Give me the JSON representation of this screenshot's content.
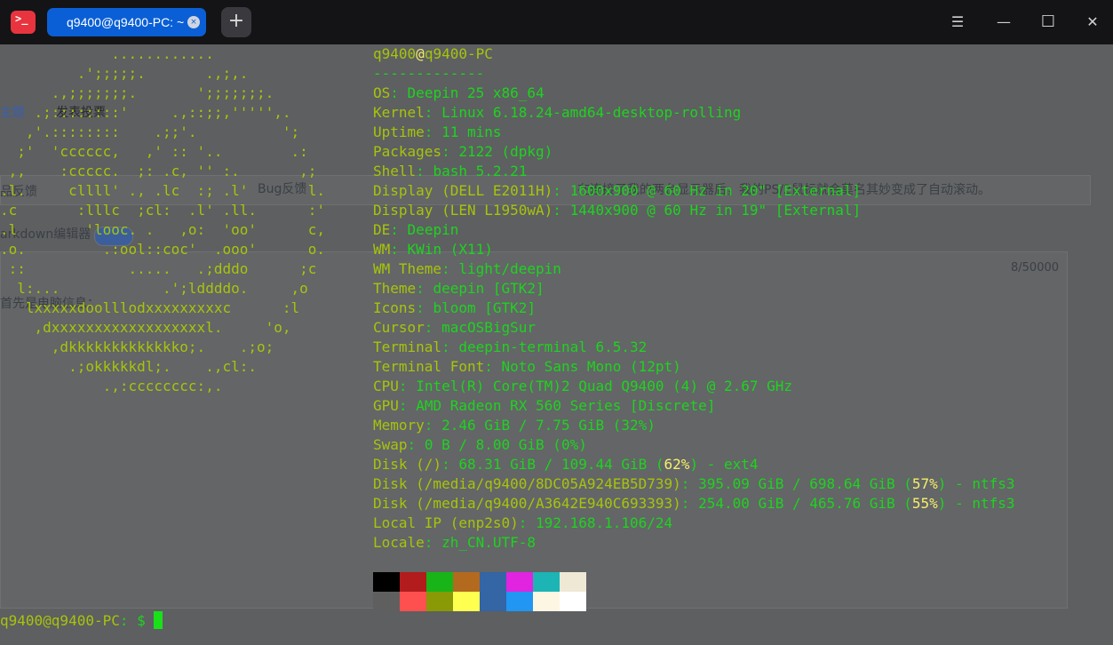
{
  "titlebar": {
    "app_icon_glyph": ">_",
    "tab_title": "q9400@q9400-PC: ~",
    "tab_close_glyph": "×",
    "new_tab_glyph": "+",
    "menu_glyph": "☰",
    "minimize_glyph": "—",
    "maximize_glyph": "☐",
    "close_glyph": "✕"
  },
  "background_page": {
    "title_fragment": "主题",
    "post_label": "发表投票",
    "feedback_label": "品反馈",
    "bug_label": "Bug反馈",
    "editor_label": "arkdown编辑器",
    "counter": "8/50000",
    "body_text": "首先是电脑信息：",
    "post_text": "在连接了我的两台显示器后，我的PS/2鼠标就会莫名其妙变成了自动滚动。"
  },
  "terminal": {
    "ascii_logo": [
      "             ............",
      "         .';;;;;.       .,;,.",
      "      .,;;;;;;;.       ';;;;;;;.",
      "    .;::::::::'     .,::;;,''''',.",
      "   ,'.::::::::    .;;'.          ';",
      "  ;'  'cccccc,   ,' :: '..        .:",
      " ,,    :ccccc.  ;: .c, '' :.       ,;",
      ".l.     cllll' ., .lc  :; .l'       l.",
      ".c       :lllc  ;cl:  .l' .ll.      :'",
      ".l        'looc. .   ,o:  'oo'      c,",
      ".o.         .:ool::coc'  .ooo'      o.",
      " ::            .....   .;dddo      ;c",
      "  l:...            .';lddddo.     ,o",
      "   lxxxxxdoolllodxxxxxxxxxc      :l",
      "    ,dxxxxxxxxxxxxxxxxxxl.     'o,",
      "      ,dkkkkkkkkkkkkko;.    .;o;",
      "        .;okkkkkdl;.    .,cl:.",
      "            .,:cccccccc:,."
    ],
    "header": {
      "user": "q9400",
      "at": "@",
      "host": "q9400-PC",
      "separator": "-------------"
    },
    "info": [
      {
        "key": "OS",
        "value": "Deepin 25 x86_64"
      },
      {
        "key": "Kernel",
        "value": "Linux 6.18.24-amd64-desktop-rolling"
      },
      {
        "key": "Uptime",
        "value": "11 mins"
      },
      {
        "key": "Packages",
        "value": "2122 (dpkg)"
      },
      {
        "key": "Shell",
        "value": "bash 5.2.21"
      },
      {
        "key": "Display (DELL E2011H)",
        "value": "1600x900 @ 60 Hz in 20\" [External]"
      },
      {
        "key": "Display (LEN L1950wA)",
        "value": "1440x900 @ 60 Hz in 19\" [External]"
      },
      {
        "key": "DE",
        "value": "Deepin"
      },
      {
        "key": "WM",
        "value": "KWin (X11)"
      },
      {
        "key": "WM Theme",
        "value": "light/deepin"
      },
      {
        "key": "Theme",
        "value": "deepin [GTK2]"
      },
      {
        "key": "Icons",
        "value": "bloom [GTK2]"
      },
      {
        "key": "Cursor",
        "value": "macOSBigSur"
      },
      {
        "key": "Terminal",
        "value": "deepin-terminal 6.5.32"
      },
      {
        "key": "Terminal Font",
        "value": "Noto Sans Mono (12pt)"
      },
      {
        "key": "CPU",
        "value": "Intel(R) Core(TM)2 Quad Q9400 (4) @ 2.67 GHz"
      },
      {
        "key": "GPU",
        "value": "AMD Radeon RX 560 Series [Discrete]"
      },
      {
        "key": "Memory",
        "value": "2.46 GiB / 7.75 GiB (32%)"
      },
      {
        "key": "Swap",
        "value": "0 B / 8.00 GiB (0%)"
      },
      {
        "key": "Disk (/)",
        "value_pre": "68.31 GiB / 109.44 GiB (",
        "percent": "62%",
        "value_post": ") - ext4"
      },
      {
        "key": "Disk (/media/q9400/8DC05A924EB5D739)",
        "value_pre": "395.09 GiB / 698.64 GiB (",
        "percent": "57%",
        "value_post": ") - ntfs3"
      },
      {
        "key": "Disk (/media/q9400/A3642E940C693393)",
        "value_pre": "254.00 GiB / 465.76 GiB (",
        "percent": "55%",
        "value_post": ") - ntfs3"
      },
      {
        "key": "Local IP (enp2s0)",
        "value": "192.168.1.106/24"
      },
      {
        "key": "Locale",
        "value": "zh_CN.UTF-8"
      }
    ],
    "colon": ":",
    "palette_row1": [
      "#000000",
      "#b21c1c",
      "#18b418",
      "#b46a1e",
      "#3465a4",
      "#e024e0",
      "#1cb4b4",
      "#eee8d5"
    ],
    "palette_row2": [
      "#5f5f5f",
      "#ff5050",
      "#8a9a06",
      "#ffff50",
      "#3465a4",
      "#2196f3",
      "#fdf6e3",
      "#ffffff"
    ],
    "prompt": {
      "userhost": "q9400@q9400-PC",
      "path": ": ",
      "symbol": "$"
    }
  }
}
